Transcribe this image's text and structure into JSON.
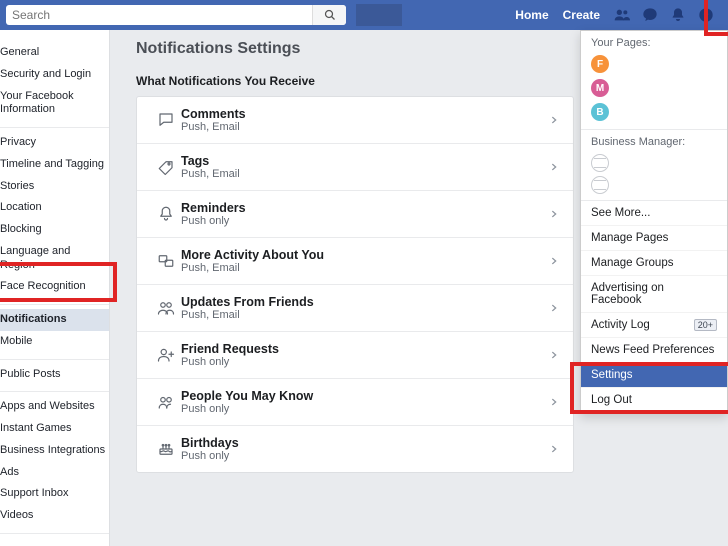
{
  "topbar": {
    "search_placeholder": "Search",
    "home": "Home",
    "create": "Create"
  },
  "sidebar": {
    "g1": [
      "General",
      "Security and Login",
      "Your Facebook Information"
    ],
    "g2": [
      "Privacy",
      "Timeline and Tagging",
      "Stories",
      "Location",
      "Blocking",
      "Language and Region",
      "Face Recognition"
    ],
    "g3": [
      "Notifications",
      "Mobile"
    ],
    "g4": [
      "Public Posts"
    ],
    "g5": [
      "Apps and Websites",
      "Instant Games",
      "Business Integrations",
      "Ads",
      "Support Inbox",
      "Videos"
    ],
    "active": "Notifications"
  },
  "main": {
    "title": "Notifications Settings",
    "section": "What Notifications You Receive",
    "items": [
      {
        "icon": "comment",
        "title": "Comments",
        "sub": "Push, Email"
      },
      {
        "icon": "tag",
        "title": "Tags",
        "sub": "Push, Email"
      },
      {
        "icon": "bell",
        "title": "Reminders",
        "sub": "Push only"
      },
      {
        "icon": "activity",
        "title": "More Activity About You",
        "sub": "Push, Email"
      },
      {
        "icon": "friends",
        "title": "Updates From Friends",
        "sub": "Push, Email"
      },
      {
        "icon": "request",
        "title": "Friend Requests",
        "sub": "Push only"
      },
      {
        "icon": "people",
        "title": "People You May Know",
        "sub": "Push only"
      },
      {
        "icon": "birthday",
        "title": "Birthdays",
        "sub": "Push only"
      }
    ]
  },
  "dropdown": {
    "your_pages": "Your Pages:",
    "page_initials": [
      "F",
      "M",
      "B"
    ],
    "business_manager": "Business Manager:",
    "see_more": "See More...",
    "items_a": [
      "Manage Pages",
      "Manage Groups",
      "Advertising on Facebook"
    ],
    "activity_log": "Activity Log",
    "activity_badge": "20+",
    "newsfeed": "News Feed Preferences",
    "settings": "Settings",
    "logout": "Log Out"
  }
}
